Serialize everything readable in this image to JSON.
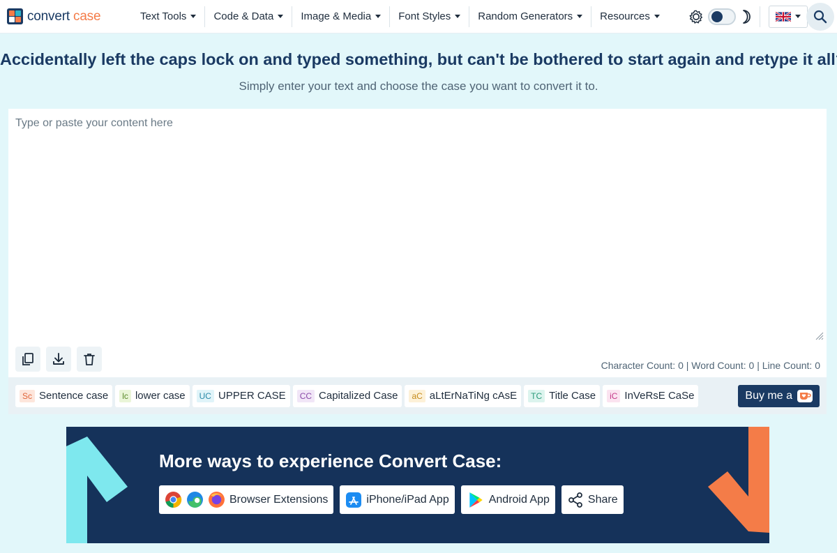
{
  "logo": {
    "text": "convert",
    "accent_text": "case",
    "colors": [
      "#f47c48",
      "#2fb4c8",
      "#ffffff",
      "#f47c48"
    ]
  },
  "nav": [
    {
      "label": "Text Tools"
    },
    {
      "label": "Code & Data"
    },
    {
      "label": "Image & Media"
    },
    {
      "label": "Font Styles"
    },
    {
      "label": "Random Generators"
    },
    {
      "label": "Resources"
    }
  ],
  "theme": {
    "light_icon": "gear-sun-icon",
    "dark_icon": "moon-icon",
    "mode": "light"
  },
  "language": {
    "flag": "uk-flag-icon"
  },
  "search": {
    "icon": "search-icon"
  },
  "headline": "Accidentally left the caps lock on and typed something, but can't be bothered to start again and retype it all?",
  "subline": "Simply enter your text and choose the case you want to convert it to.",
  "editor": {
    "placeholder": "Type or paste your content here",
    "value": "",
    "tools": [
      "copy-icon",
      "download-icon",
      "trash-icon"
    ],
    "counts_text": "Character Count: 0 | Word Count: 0 | Line Count: 0"
  },
  "cases": [
    {
      "badge": "Sc",
      "label": "Sentence case",
      "badge_bg": "#fde6dc",
      "badge_fg": "#e0653a"
    },
    {
      "badge": "lc",
      "label": "lower case",
      "badge_bg": "#eaf5d8",
      "badge_fg": "#5a8a2a"
    },
    {
      "badge": "UC",
      "label": "UPPER CASE",
      "badge_bg": "#e0f4f9",
      "badge_fg": "#2a8aa8"
    },
    {
      "badge": "CC",
      "label": "Capitalized Case",
      "badge_bg": "#f1e6f7",
      "badge_fg": "#8a4aa8"
    },
    {
      "badge": "aC",
      "label": "aLtErNaTiNg cAsE",
      "badge_bg": "#fdf1d8",
      "badge_fg": "#c58a1a"
    },
    {
      "badge": "TC",
      "label": "Title Case",
      "badge_bg": "#dcf4ee",
      "badge_fg": "#2a9a7a"
    },
    {
      "badge": "iC",
      "label": "InVeRsE CaSe",
      "badge_bg": "#fbe3f0",
      "badge_fg": "#c43a8a"
    }
  ],
  "buy": {
    "label": "Buy me a",
    "icon": "coffee-cup-icon"
  },
  "promo": {
    "title": "More ways to experience Convert Case:",
    "buttons": [
      {
        "label": "Browser Extensions",
        "icons": [
          "chrome-icon",
          "edge-icon",
          "firefox-icon"
        ]
      },
      {
        "label": "iPhone/iPad App",
        "icons": [
          "app-store-icon"
        ]
      },
      {
        "label": "Android App",
        "icons": [
          "google-play-icon"
        ]
      },
      {
        "label": "Share",
        "icons": [
          "share-icon"
        ]
      }
    ],
    "colors": {
      "bg": "#15325a",
      "left_arrow": "#7ee8ee",
      "right_arrow": "#f47c48"
    }
  }
}
